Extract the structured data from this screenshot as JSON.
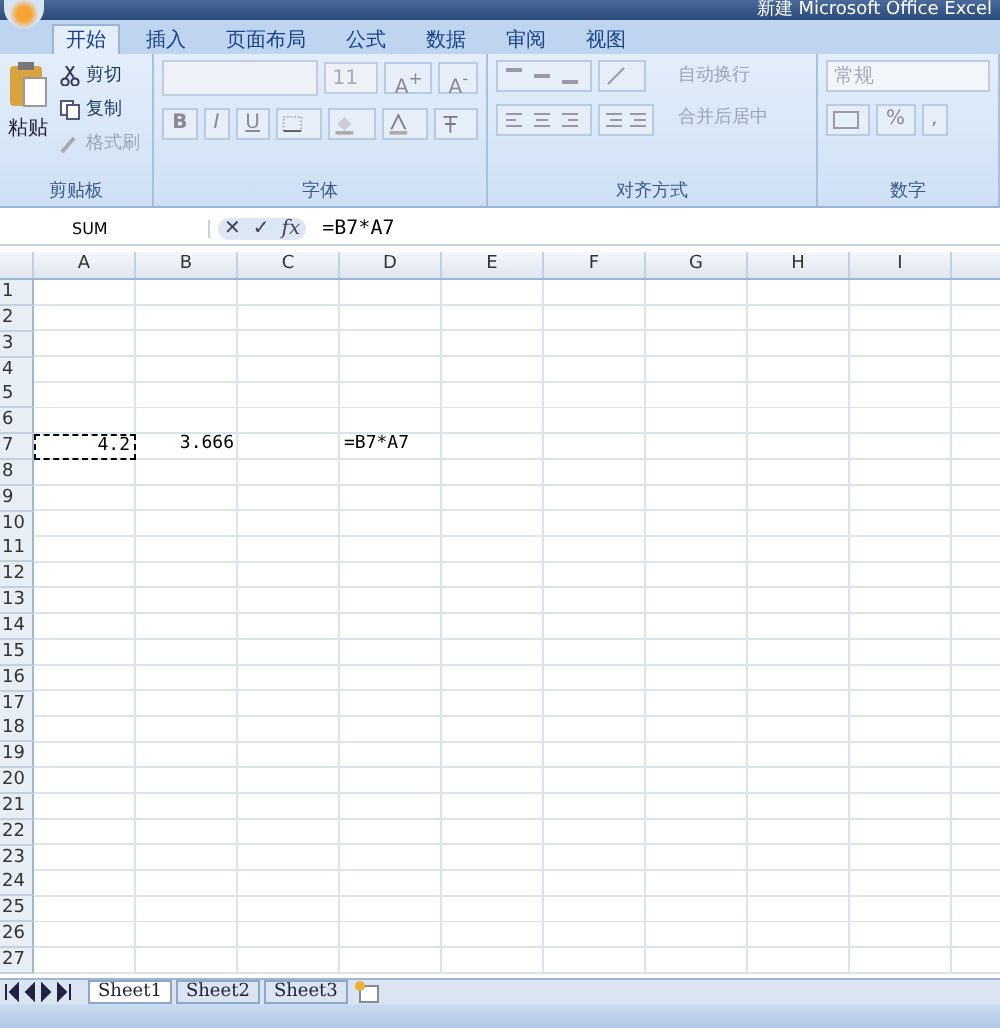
{
  "window": {
    "title": "新建 Microsoft Office Excel"
  },
  "ribbon_tabs": [
    {
      "label": "开始",
      "selected": true
    },
    {
      "label": "插入",
      "selected": false
    },
    {
      "label": "页面布局",
      "selected": false
    },
    {
      "label": "公式",
      "selected": false
    },
    {
      "label": "数据",
      "selected": false
    },
    {
      "label": "审阅",
      "selected": false
    },
    {
      "label": "视图",
      "selected": false
    }
  ],
  "clipboard": {
    "paste": "粘贴",
    "cut": "剪切",
    "copy": "复制",
    "format_painter": "格式刷",
    "label": "剪贴板"
  },
  "font": {
    "size": "11",
    "grow": "A$^{+}$",
    "shrink": "A$^{-}$",
    "bold": "B",
    "italic": "I",
    "underline": "U",
    "label": "字体"
  },
  "alignment": {
    "wrap": "自动换行",
    "merge": "合并后居中",
    "label": "对齐方式"
  },
  "number": {
    "format": "常规",
    "percent": "%",
    "comma": ",",
    "label": "数字"
  },
  "formula_bar": {
    "name_box": "SUM",
    "cancel": "✕",
    "enter": "✓",
    "function": "fx",
    "formula": "=B7*A7"
  },
  "columns": [
    "A",
    "B",
    "C",
    "D",
    "E",
    "F",
    "G",
    "H",
    "I"
  ],
  "rows": [
    {
      "header": "1"
    },
    {
      "header": "2"
    },
    {
      "header": "3"
    },
    {
      "header": "4"
    },
    {
      "header": "5"
    },
    {
      "header": "6"
    },
    {
      "header": "7",
      "cells": [
        {
          "kind": "number",
          "text": "4.2",
          "marquee": true
        },
        {
          "kind": "number",
          "text": "3.666",
          "marquee": false
        },
        null,
        {
          "kind": "text",
          "text": "=B7*A7",
          "marquee": false
        }
      ]
    },
    {
      "header": "8"
    },
    {
      "header": "9"
    },
    {
      "header": "10"
    },
    {
      "header": "11"
    },
    {
      "header": "12"
    },
    {
      "header": "13"
    },
    {
      "header": "14"
    },
    {
      "header": "15"
    },
    {
      "header": "16"
    },
    {
      "header": "17"
    },
    {
      "header": "18"
    },
    {
      "header": "19"
    },
    {
      "header": "20"
    },
    {
      "header": "21"
    },
    {
      "header": "22"
    },
    {
      "header": "23"
    },
    {
      "header": "24"
    },
    {
      "header": "25"
    },
    {
      "header": "26"
    },
    {
      "header": "27"
    }
  ],
  "sheets": [
    {
      "label": "Sheet1",
      "selected": true
    },
    {
      "label": "Sheet2",
      "selected": false
    },
    {
      "label": "Sheet3",
      "selected": false
    }
  ]
}
